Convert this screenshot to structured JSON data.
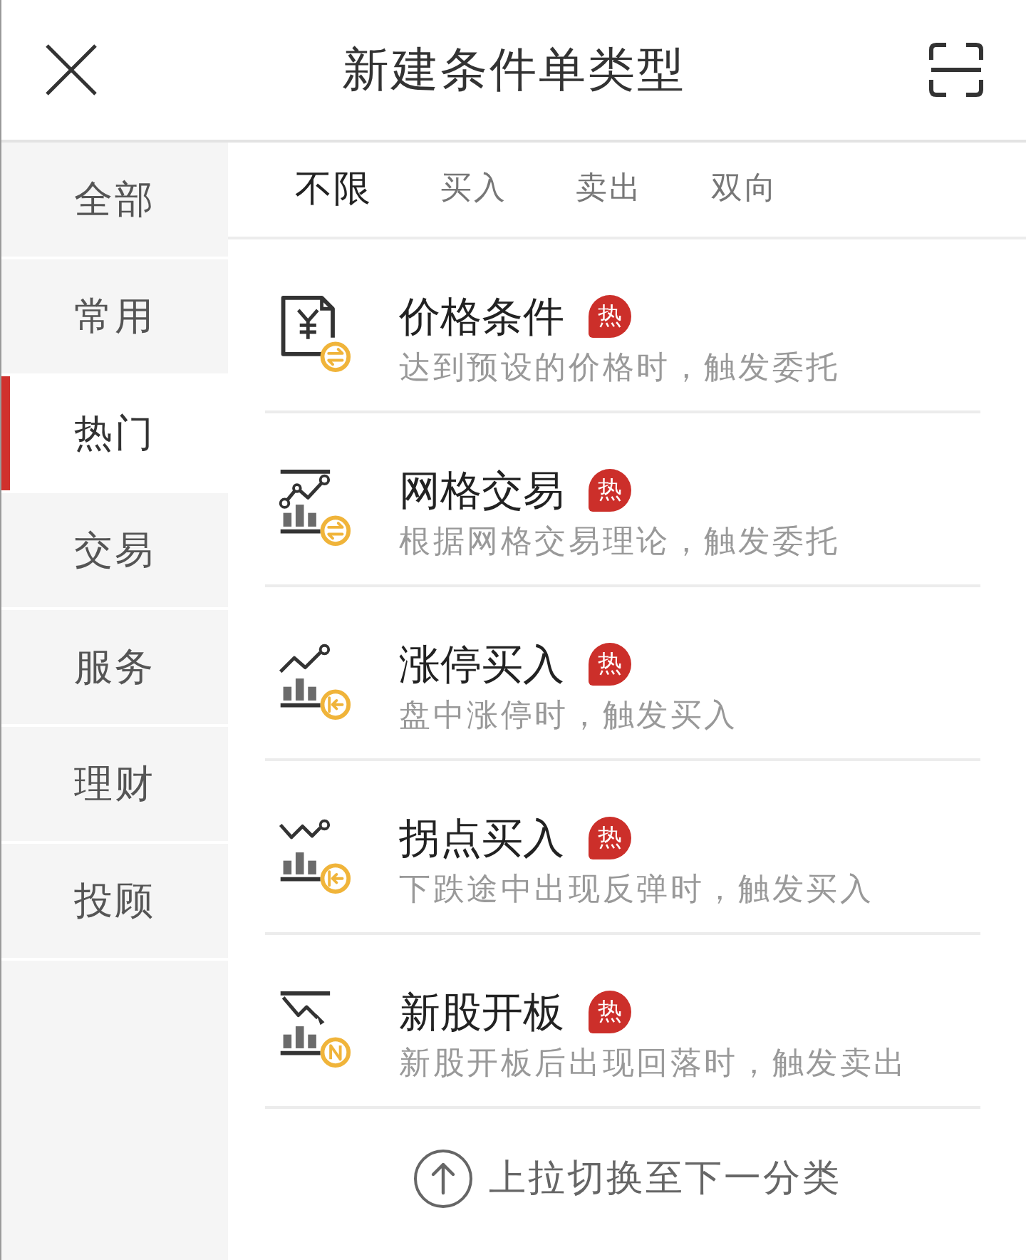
{
  "header": {
    "title": "新建条件单类型"
  },
  "sidebar": {
    "items": [
      {
        "label": "全部",
        "selected": false
      },
      {
        "label": "常用",
        "selected": false
      },
      {
        "label": "热门",
        "selected": true
      },
      {
        "label": "交易",
        "selected": false
      },
      {
        "label": "服务",
        "selected": false
      },
      {
        "label": "理财",
        "selected": false
      },
      {
        "label": "投顾",
        "selected": false
      }
    ]
  },
  "filter_tabs": [
    {
      "label": "不限",
      "selected": true
    },
    {
      "label": "买入",
      "selected": false
    },
    {
      "label": "卖出",
      "selected": false
    },
    {
      "label": "双向",
      "selected": false
    }
  ],
  "conditions": [
    {
      "kind": "price",
      "title": "价格条件",
      "badge": "热",
      "description": "达到预设的价格时，触发委托"
    },
    {
      "kind": "grid",
      "title": "网格交易",
      "badge": "热",
      "description": "根据网格交易理论，触发委托"
    },
    {
      "kind": "limit_up",
      "title": "涨停买入",
      "badge": "热",
      "description": "盘中涨停时，触发买入"
    },
    {
      "kind": "turning_point",
      "title": "拐点买入",
      "badge": "热",
      "description": "下跌途中出现反弹时，触发买入"
    },
    {
      "kind": "new_stock",
      "title": "新股开板",
      "badge": "热",
      "description": "新股开板后出现回落时，触发卖出"
    }
  ],
  "footer": {
    "hint": "上拉切换至下一分类"
  }
}
